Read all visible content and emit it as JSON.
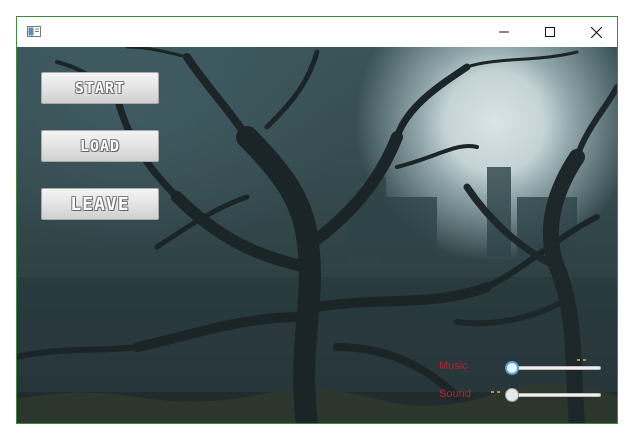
{
  "window": {
    "title": "",
    "controls": {
      "minimize": "minimize",
      "maximize": "maximize",
      "close": "close"
    }
  },
  "menu": {
    "start_label": "START",
    "load_label": "LOAD",
    "leave_label": "LEAVE"
  },
  "audio": {
    "music_label": "Music",
    "sound_label": "Sound",
    "music_level": 0.0,
    "sound_level": 0.0
  },
  "colors": {
    "label_red": "#c21d2a",
    "window_border": "#3c8a3c",
    "slider_focus": "#4fa3de"
  },
  "icons": [
    "app-window-icon",
    "minimize-icon",
    "maximize-icon",
    "close-icon"
  ]
}
